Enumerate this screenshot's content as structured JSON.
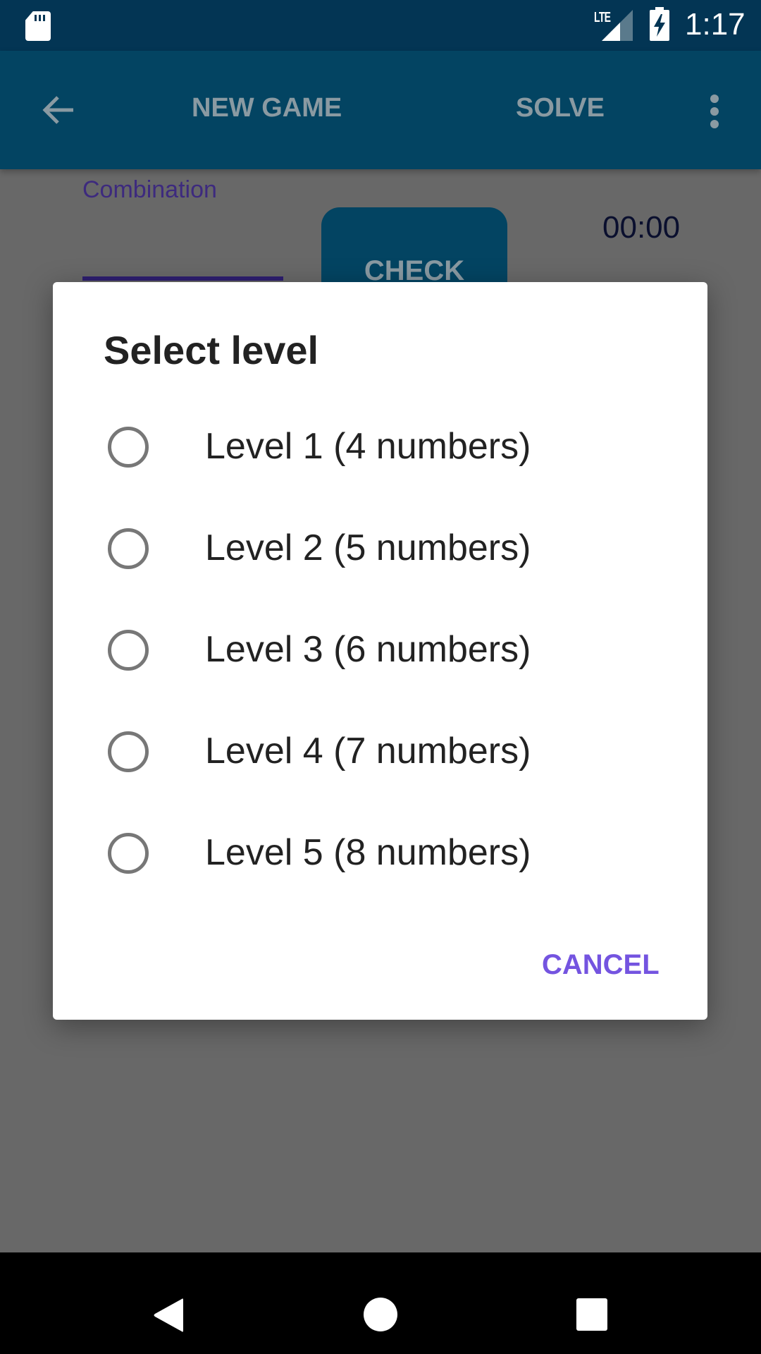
{
  "status_bar": {
    "network_label": "LTE",
    "time": "1:17",
    "icons": [
      "sd-card-icon",
      "lte-signal-icon",
      "battery-charging-icon"
    ]
  },
  "app_bar": {
    "back_icon": "arrow-left-icon",
    "new_game_label": "NEW GAME",
    "solve_label": "SOLVE",
    "overflow_icon": "more-vertical-icon"
  },
  "game": {
    "combination_label": "Combination",
    "combination_value": "",
    "check_label": "CHECK",
    "timer": "00:00"
  },
  "dialog": {
    "title": "Select level",
    "options": [
      {
        "label": "Level 1 (4 numbers)",
        "selected": false
      },
      {
        "label": "Level 2 (5 numbers)",
        "selected": false
      },
      {
        "label": "Level 3 (6 numbers)",
        "selected": false
      },
      {
        "label": "Level 4 (7 numbers)",
        "selected": false
      },
      {
        "label": "Level 5 (8 numbers)",
        "selected": false
      }
    ],
    "cancel_label": "CANCEL"
  },
  "nav_bar": {
    "icons": [
      "nav-back-icon",
      "nav-home-icon",
      "nav-recents-icon"
    ]
  },
  "colors": {
    "status_bar": "#033554",
    "app_bar": "#034462",
    "accent": "#7454e0",
    "scrim": "#686868"
  }
}
